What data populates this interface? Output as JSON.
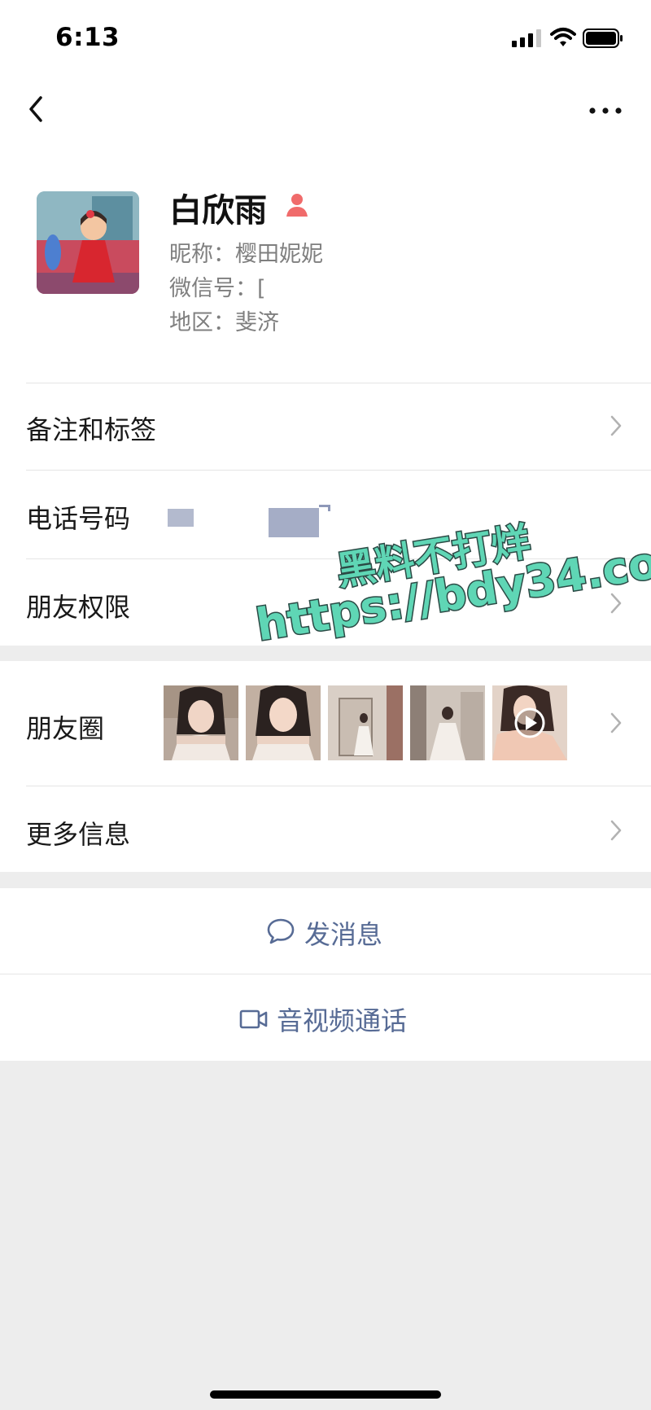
{
  "status_bar": {
    "time": "6:13"
  },
  "profile": {
    "name": "白欣雨",
    "nickname_line": "昵称：樱田妮妮",
    "wechat_id_line": "微信号：[",
    "region_line": "地区：斐济"
  },
  "rows": {
    "remarks_tags": "备注和标签",
    "phone": "电话号码",
    "friend_permissions": "朋友权限",
    "moments": "朋友圈",
    "more_info": "更多信息"
  },
  "actions": {
    "send_message": "发消息",
    "video_call": "音视频通话"
  },
  "watermark": {
    "line1": "黑料不打烊",
    "line2": "https://bdy34.co"
  },
  "colors": {
    "link_blue": "#576b95",
    "female_pink": "#f06b6b",
    "watermark_teal": "#5fd6b5"
  },
  "icons": {
    "back": "chevron-left-icon",
    "more": "more-dots-icon",
    "gender": "female-icon",
    "message": "chat-bubble-icon",
    "video": "video-camera-icon",
    "play": "play-icon"
  }
}
